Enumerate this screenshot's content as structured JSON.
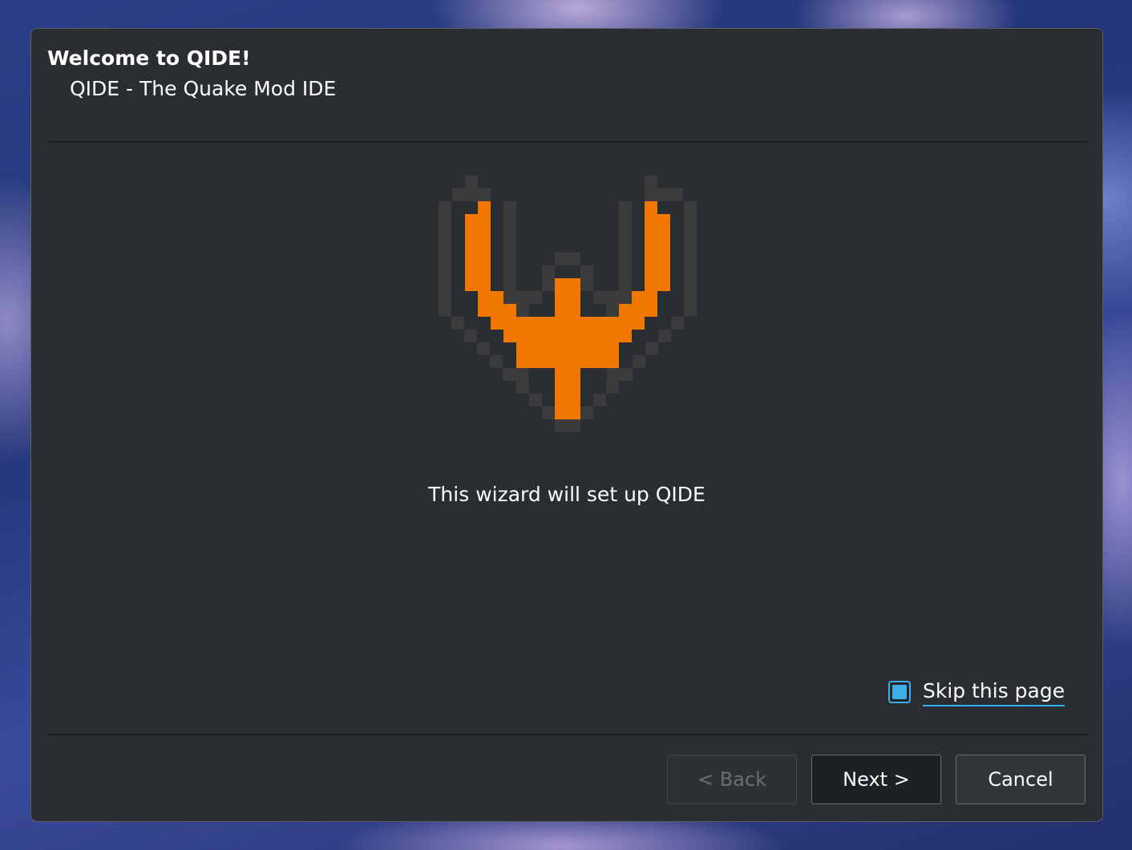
{
  "wizard": {
    "title": "Welcome to QIDE!",
    "subtitle": "QIDE - The Quake Mod IDE",
    "message": "This wizard will set up QIDE",
    "logo_icon": "qide-quake-logo-icon",
    "skip_checkbox": {
      "label": "Skip this page",
      "checked": true
    }
  },
  "buttons": {
    "back": {
      "label": "< Back",
      "enabled": false
    },
    "next": {
      "label": "Next >"
    },
    "cancel": {
      "label": "Cancel"
    }
  },
  "colors": {
    "logo_orange": "#f07800",
    "logo_outline": "#3b3b3b",
    "accent": "#3daee9",
    "dialog_bg": "#2a2e32"
  }
}
